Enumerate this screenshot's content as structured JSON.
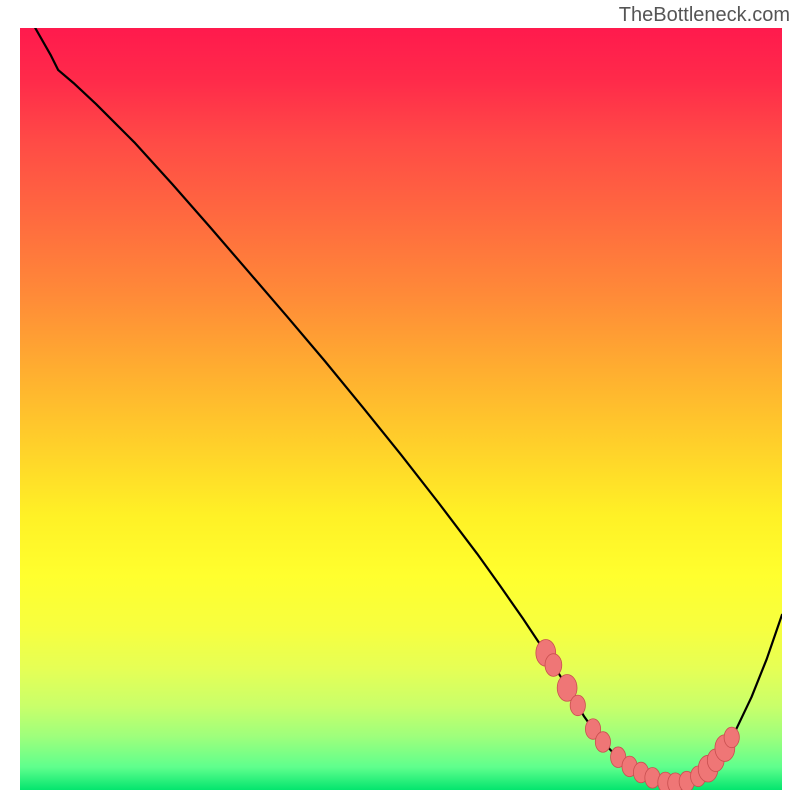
{
  "attribution": "TheBottleneck.com",
  "colors": {
    "curve": "#000000",
    "bead_fill": "#ef7676",
    "bead_stroke": "#c94f4f"
  },
  "chart_data": {
    "type": "line",
    "title": "",
    "xlabel": "",
    "ylabel": "",
    "xlim": [
      0,
      100
    ],
    "ylim": [
      0,
      100
    ],
    "grid": false,
    "legend": false,
    "series": [
      {
        "name": "bottleneck-curve",
        "x": [
          2,
          4,
          5,
          7,
          10,
          15,
          20,
          25,
          30,
          35,
          40,
          45,
          50,
          55,
          60,
          63,
          66,
          69,
          71,
          72,
          74,
          76,
          78,
          80,
          82,
          84,
          86,
          88,
          90,
          92,
          94,
          96,
          98,
          100
        ],
        "y": [
          100,
          96.5,
          94.5,
          92.8,
          90,
          85,
          79.5,
          73.8,
          68,
          62.2,
          56.3,
          50.2,
          44,
          37.6,
          31,
          26.8,
          22.5,
          18,
          14.8,
          13.1,
          9.7,
          6.9,
          4.7,
          3.1,
          2.0,
          1.2,
          0.9,
          1.3,
          2.5,
          4.7,
          8.0,
          12.2,
          17.2,
          23
        ]
      }
    ],
    "markers": [
      {
        "x": 69.0,
        "y": 18.0,
        "r": 1.3
      },
      {
        "x": 70.0,
        "y": 16.4,
        "r": 1.1
      },
      {
        "x": 71.8,
        "y": 13.4,
        "r": 1.3
      },
      {
        "x": 73.2,
        "y": 11.1,
        "r": 1.0
      },
      {
        "x": 75.2,
        "y": 8.0,
        "r": 1.0
      },
      {
        "x": 76.5,
        "y": 6.3,
        "r": 1.0
      },
      {
        "x": 78.5,
        "y": 4.3,
        "r": 1.0
      },
      {
        "x": 80.0,
        "y": 3.1,
        "r": 1.0
      },
      {
        "x": 81.5,
        "y": 2.3,
        "r": 1.0
      },
      {
        "x": 83.0,
        "y": 1.6,
        "r": 1.0
      },
      {
        "x": 84.7,
        "y": 1.0,
        "r": 1.0
      },
      {
        "x": 86.0,
        "y": 0.9,
        "r": 1.0
      },
      {
        "x": 87.5,
        "y": 1.1,
        "r": 1.0
      },
      {
        "x": 89.0,
        "y": 1.8,
        "r": 1.0
      },
      {
        "x": 90.3,
        "y": 2.8,
        "r": 1.3
      },
      {
        "x": 91.3,
        "y": 3.9,
        "r": 1.1
      },
      {
        "x": 92.5,
        "y": 5.5,
        "r": 1.3
      },
      {
        "x": 93.4,
        "y": 6.9,
        "r": 1.0
      }
    ]
  }
}
